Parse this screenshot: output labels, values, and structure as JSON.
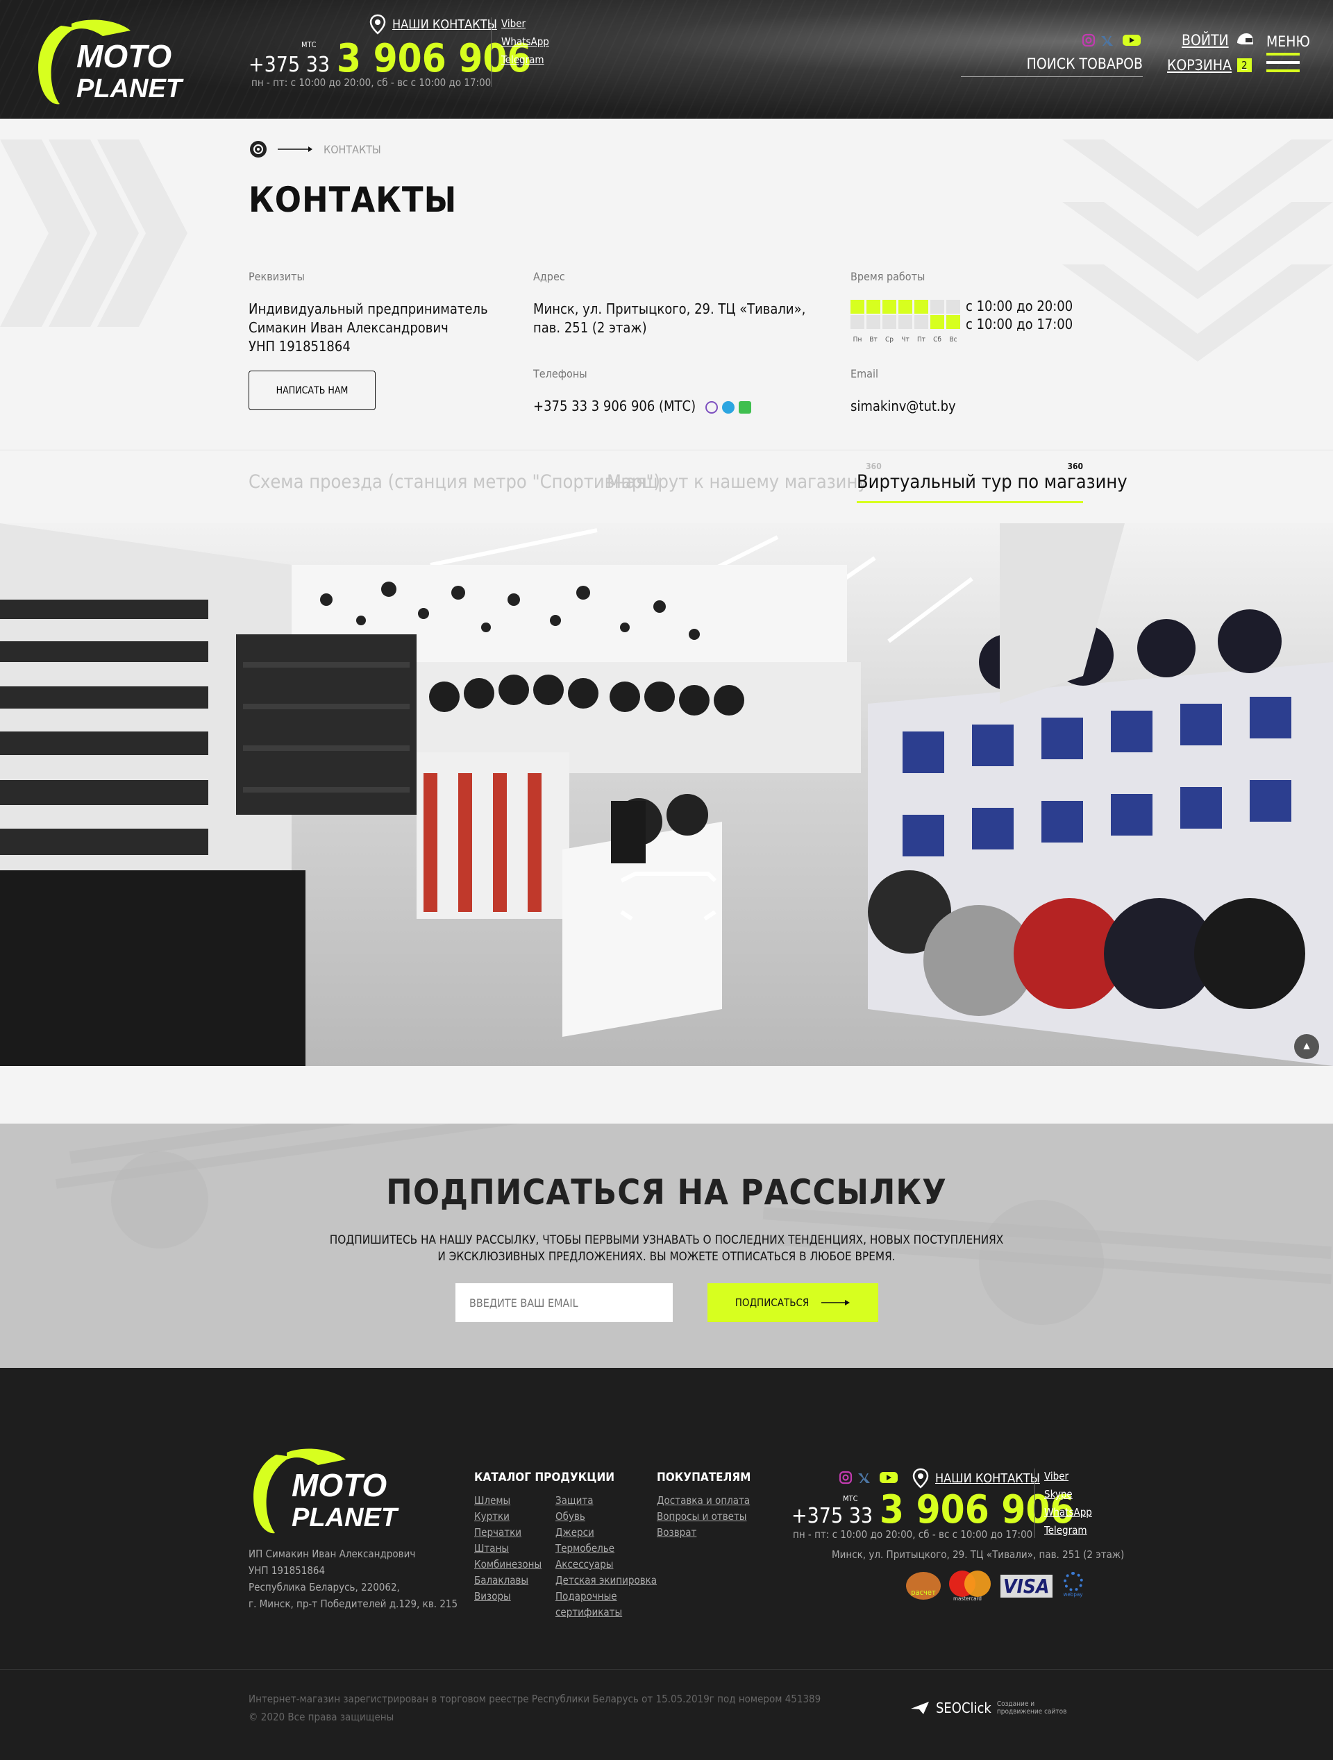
{
  "header": {
    "contacts_link": "НАШИ КОНТАКТЫ",
    "phone_prefix": "+375 33",
    "phone_operator": "МТС",
    "phone_number": "3 906 906",
    "hours": "пн - пт: с 10:00 до 20:00,    сб - вс  с 10:00 до 17:00",
    "messengers": [
      "Viber",
      "WhatsApp",
      "Telegram"
    ],
    "login": "ВОЙТИ",
    "search": "ПОИСК ТОВАРОВ",
    "cart": "КОРЗИНА",
    "cart_count": "2",
    "menu": "МЕНЮ"
  },
  "breadcrumb": {
    "current": "КОНТАКТЫ"
  },
  "page_title": "КОНТАКТЫ",
  "requisites": {
    "label": "Реквизиты",
    "line1": "Индивидуальный предприниматель",
    "line2": "Симакин Иван Александрович",
    "line3": "УНП 191851864",
    "button": "НАПИСАТЬ НАМ"
  },
  "address": {
    "label": "Адрес",
    "line1": "Минск, ул. Притыцкого, 29. ТЦ «Тивали»,",
    "line2": "пав. 251 (2 этаж)"
  },
  "phones": {
    "label": "Телефоны",
    "value": "+375 33 3 906 906 (МТС)"
  },
  "schedule": {
    "label": "Время работы",
    "days": [
      "Пн",
      "Вт",
      "Ср",
      "Чт",
      "Пт",
      "Сб",
      "Вс"
    ],
    "weekday_hours": "с 10:00 до 20:00",
    "weekend_hours": "с 10:00 до 17:00"
  },
  "email": {
    "label": "Email",
    "value": "simakinv@tut.by"
  },
  "tabs": [
    {
      "label": "Схема проезда (станция метро \"Спортивная\")"
    },
    {
      "label": "Маршрут к нашему магазину",
      "badge": "360"
    },
    {
      "label": "Виртуальный тур по магазину",
      "badge": "360"
    }
  ],
  "subscribe": {
    "title": "ПОДПИСАТЬСЯ НА РАССЫЛКУ",
    "text1": "ПОДПИШИТЕСЬ НА НАШУ РАССЫЛКУ, ЧТОБЫ ПЕРВЫМИ УЗНАВАТЬ О ПОСЛЕДНИХ ТЕНДЕНЦИЯХ, НОВЫХ ПОСТУПЛЕНИЯХ",
    "text2": "И ЭКСКЛЮЗИВНЫХ ПРЕДЛОЖЕНИЯХ. ВЫ МОЖЕТЕ ОТПИСАТЬСЯ В ЛЮБОЕ ВРЕМЯ.",
    "placeholder": "ВВЕДИТЕ ВАШ EMAIL",
    "button": "ПОДПИСАТЬСЯ"
  },
  "footer": {
    "legal": [
      "ИП Симакин Иван Александрович",
      "УНП 191851864",
      "Республика Беларусь, 220062,",
      "г. Минск, пр-т Победителей д.129, кв. 215"
    ],
    "catalog_title": "КАТАЛОГ ПРОДУКЦИИ",
    "catalog_col1": [
      "Шлемы",
      "Куртки",
      "Перчатки",
      "Штаны",
      "Комбинезоны",
      "Балаклавы",
      "Визоры"
    ],
    "catalog_col2": [
      "Защита",
      "Обувь",
      "Джерси",
      "Термобелье",
      "Аксессуары",
      "Детская экипировка",
      "Подарочные",
      "сертификаты"
    ],
    "buyers_title": "ПОКУПАТЕЛЯМ",
    "buyers": [
      "Доставка и оплата",
      "Вопросы и ответы",
      "Возврат"
    ],
    "contacts_link": "НАШИ КОНТАКТЫ",
    "phone_prefix": "+375 33",
    "phone_operator": "МТС",
    "phone_number": "3 906 906",
    "hours": "пн - пт: с 10:00 до 20:00,     сб - вс  с 10:00 до 17:00",
    "address": "Минск, ул. Притыцкого, 29. ТЦ «Тивали», пав. 251 (2 этаж)",
    "messengers": [
      "Viber",
      "Skype",
      "WhatsApp",
      "Telegram"
    ],
    "payments": [
      "расчет",
      "mastercard",
      "VISA",
      "webpay"
    ],
    "registry": "Интернет-магазин зарегистрирован в торговом реестре Республики Беларусь от 15.05.2019г под номером 451389",
    "copyright": "© 2020 Все права защищены",
    "seo_brand": "SEOClick",
    "seo_line1": "Создание и",
    "seo_line2": "продвижение сайтов"
  },
  "colors": {
    "accent": "#d7ff1f",
    "dark": "#1e1e1e"
  }
}
